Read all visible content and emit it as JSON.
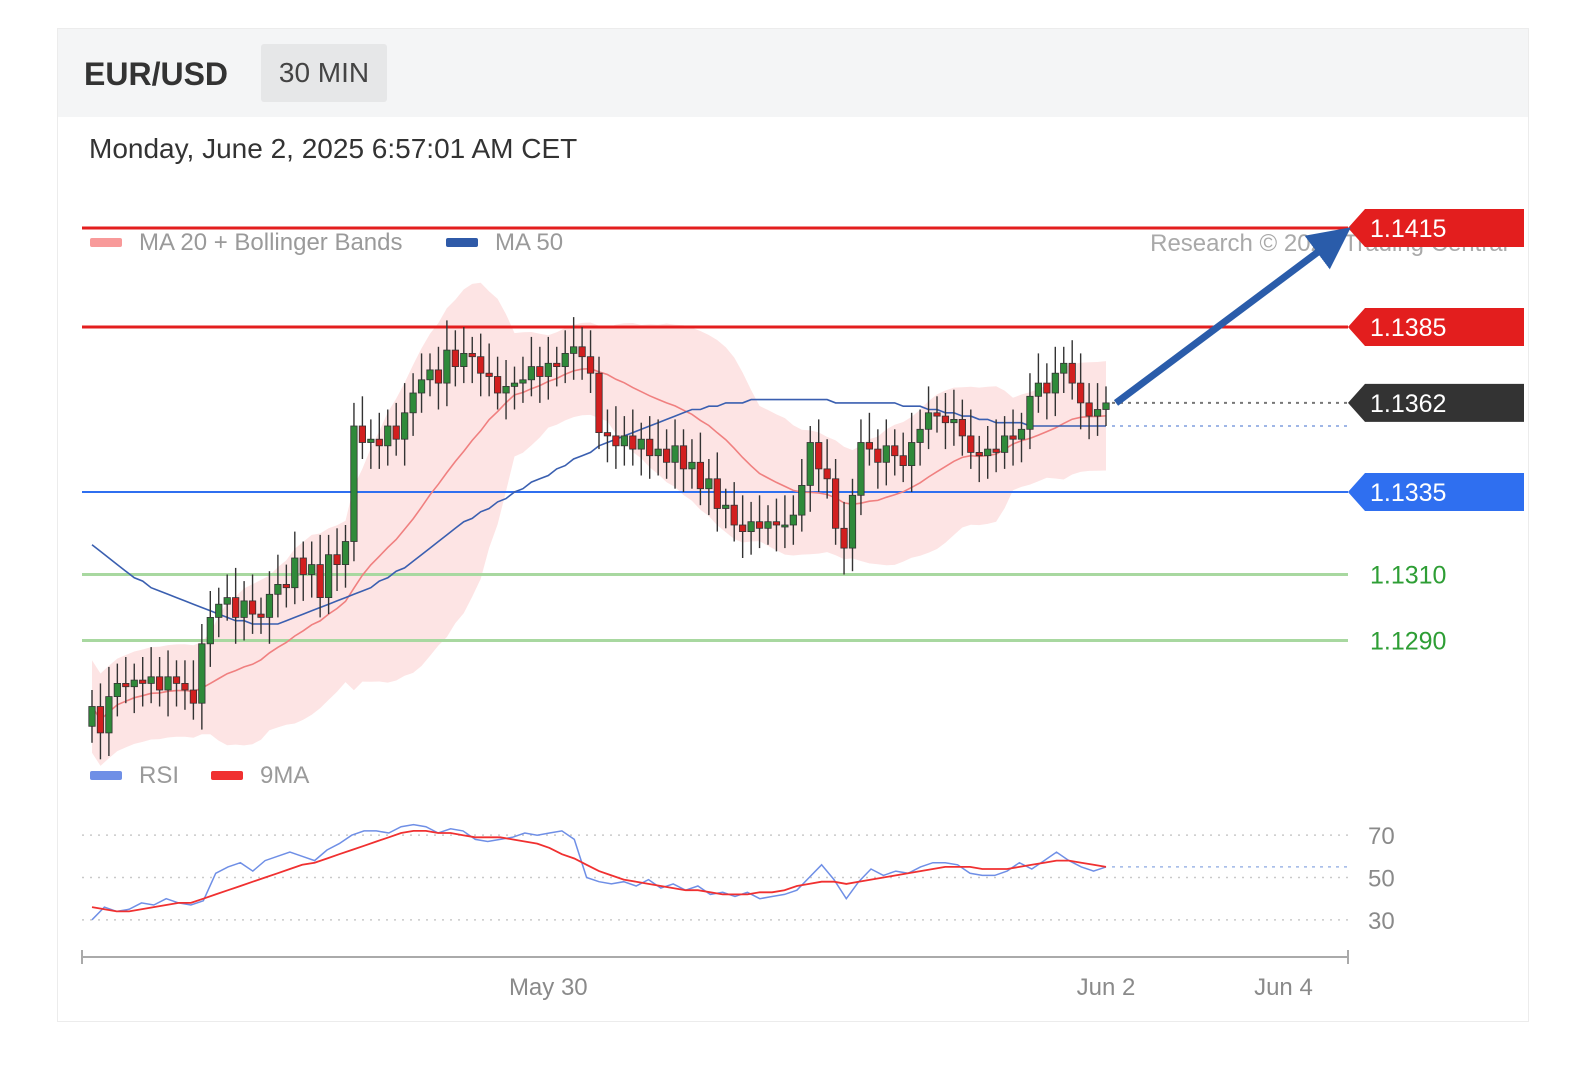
{
  "header": {
    "pair": "EUR/USD",
    "timeframe": "30 MIN"
  },
  "date": "Monday, June 2, 2025 6:57:01 AM CET",
  "legend": {
    "bb_label": "MA 20 + Bollinger Bands",
    "ma50_label": "MA 50",
    "rsi_label": "RSI",
    "rsi_ma_label": "9MA"
  },
  "credit": "Research © 2025 Trading Central",
  "colors": {
    "bullish": "#2f8a3a",
    "bearish": "#d21f1f",
    "band": "#fde4e4",
    "ma20": "#f08080",
    "ma50": "#3a5fb0",
    "resistance": "#e31e1e",
    "support_line": "#a8d8a0",
    "support_text": "#2e9e35",
    "pivot": "#2f6ff0",
    "current": "#333333",
    "arrow": "#2a5caa",
    "rsi": "#6f8fe6",
    "rsi_ma": "#f03030"
  },
  "chart_data": [
    {
      "type": "candlestick",
      "ylim": [
        1.1245,
        1.1445
      ],
      "levels": [
        {
          "label": "1.1415",
          "value": 1.1415,
          "kind": "resistance"
        },
        {
          "label": "1.1385",
          "value": 1.1385,
          "kind": "resistance"
        },
        {
          "label": "1.1362",
          "value": 1.1362,
          "kind": "current"
        },
        {
          "label": "1.1335",
          "value": 1.1335,
          "kind": "pivot"
        },
        {
          "label": "1.1310",
          "value": 1.131,
          "kind": "support"
        },
        {
          "label": "1.1290",
          "value": 1.129,
          "kind": "support"
        }
      ],
      "projection": {
        "direction": "up",
        "from": 1.1362,
        "to": 1.1415
      },
      "x_tick_labels": [
        "May 30",
        "Jun 2",
        "Jun 4"
      ],
      "x_ticks": [
        {
          "label": "May 30",
          "bar": 54
        },
        {
          "label": "Jun 2",
          "bar": 120
        },
        {
          "label": "Jun 4",
          "bar": 141
        }
      ],
      "candles_close": [
        1.127,
        1.1262,
        1.1273,
        1.1277,
        1.1276,
        1.1278,
        1.1277,
        1.1279,
        1.1275,
        1.1279,
        1.1277,
        1.1275,
        1.1271,
        1.1289,
        1.1297,
        1.1301,
        1.1303,
        1.1297,
        1.1302,
        1.1298,
        1.1297,
        1.1304,
        1.1307,
        1.1306,
        1.1315,
        1.131,
        1.1313,
        1.1303,
        1.1316,
        1.1313,
        1.132,
        1.1355,
        1.135,
        1.1351,
        1.1349,
        1.1355,
        1.1351,
        1.1359,
        1.1365,
        1.1369,
        1.1372,
        1.1368,
        1.1378,
        1.1373,
        1.1377,
        1.1376,
        1.1371,
        1.137,
        1.1365,
        1.1367,
        1.1368,
        1.1369,
        1.1373,
        1.137,
        1.1374,
        1.1373,
        1.1377,
        1.1379,
        1.1376,
        1.1371,
        1.1353,
        1.1352,
        1.1349,
        1.1352,
        1.1348,
        1.1351,
        1.1346,
        1.1348,
        1.1344,
        1.1349,
        1.1342,
        1.1344,
        1.1336,
        1.1339,
        1.133,
        1.1331,
        1.1325,
        1.1323,
        1.1326,
        1.1324,
        1.1326,
        1.1325,
        1.1325,
        1.1328,
        1.1337,
        1.135,
        1.1342,
        1.1339,
        1.1324,
        1.1318,
        1.1334,
        1.135,
        1.1348,
        1.1344,
        1.1349,
        1.1346,
        1.1343,
        1.135,
        1.1354,
        1.1359,
        1.1358,
        1.1356,
        1.1357,
        1.1352,
        1.1347,
        1.1346,
        1.1348,
        1.1347,
        1.1352,
        1.1351,
        1.1354,
        1.1364,
        1.1368,
        1.1365,
        1.1371,
        1.1374,
        1.1368,
        1.1362,
        1.1358,
        1.136,
        1.1362
      ],
      "ma50": [
        1.1319,
        1.1317,
        1.1315,
        1.1313,
        1.1311,
        1.1309,
        1.1308,
        1.1306,
        1.1305,
        1.1304,
        1.1303,
        1.1302,
        1.1301,
        1.13,
        1.1299,
        1.1298,
        1.1297,
        1.1296,
        1.1296,
        1.1295,
        1.1295,
        1.1295,
        1.1295,
        1.1296,
        1.1297,
        1.1298,
        1.1299,
        1.13,
        1.1301,
        1.1302,
        1.1303,
        1.1304,
        1.1305,
        1.1306,
        1.1308,
        1.1309,
        1.1311,
        1.1312,
        1.1314,
        1.1316,
        1.1318,
        1.132,
        1.1322,
        1.1324,
        1.1326,
        1.1327,
        1.1329,
        1.133,
        1.1332,
        1.1333,
        1.1335,
        1.1336,
        1.1338,
        1.1339,
        1.134,
        1.1342,
        1.1343,
        1.1345,
        1.1346,
        1.1347,
        1.1349,
        1.135,
        1.1351,
        1.1352,
        1.1353,
        1.1354,
        1.1355,
        1.1356,
        1.1357,
        1.1358,
        1.1359,
        1.136,
        1.136,
        1.1361,
        1.1361,
        1.1362,
        1.1362,
        1.1362,
        1.1363,
        1.1363,
        1.1363,
        1.1363,
        1.1363,
        1.1363,
        1.1363,
        1.1363,
        1.1363,
        1.1363,
        1.1362,
        1.1362,
        1.1362,
        1.1362,
        1.1362,
        1.1362,
        1.1362,
        1.1362,
        1.1361,
        1.1361,
        1.1361,
        1.136,
        1.136,
        1.1359,
        1.1359,
        1.1358,
        1.1358,
        1.1357,
        1.1357,
        1.1356,
        1.1356,
        1.1356,
        1.1356,
        1.1355,
        1.1355,
        1.1355,
        1.1355,
        1.1355,
        1.1355,
        1.1355,
        1.1355,
        1.1355,
        1.1355
      ]
    },
    {
      "type": "line",
      "name": "RSI",
      "ylim": [
        20,
        80
      ],
      "reference_lines": [
        70,
        50,
        30
      ],
      "rsi": [
        30,
        36,
        34,
        35,
        38,
        37,
        40,
        38,
        37,
        39,
        52,
        55,
        57,
        53,
        58,
        60,
        62,
        60,
        58,
        63,
        66,
        70,
        72,
        72,
        71,
        74,
        75,
        74,
        71,
        73,
        72,
        68,
        67,
        68,
        69,
        71,
        70,
        71,
        72,
        68,
        50,
        48,
        47,
        48,
        46,
        49,
        45,
        47,
        44,
        46,
        42,
        43,
        41,
        43,
        40,
        41,
        42,
        44,
        50,
        56,
        49,
        40,
        48,
        54,
        51,
        53,
        52,
        55,
        57,
        57,
        56,
        52,
        51,
        51,
        53,
        57,
        54,
        58,
        62,
        58,
        55,
        53,
        55
      ],
      "rsi_9ma": [
        36,
        35,
        34,
        34,
        35,
        36,
        37,
        38,
        38,
        40,
        42,
        44,
        46,
        48,
        50,
        52,
        54,
        56,
        57,
        59,
        61,
        63,
        65,
        67,
        69,
        71,
        72,
        72,
        71,
        71,
        70,
        69,
        69,
        69,
        68,
        67,
        66,
        64,
        61,
        59,
        56,
        53,
        51,
        49,
        48,
        47,
        46,
        45,
        44,
        44,
        43,
        42,
        42,
        42,
        43,
        43,
        44,
        46,
        47,
        48,
        48,
        47,
        48,
        49,
        50,
        51,
        52,
        53,
        54,
        55,
        55,
        55,
        54,
        54,
        54,
        55,
        56,
        57,
        58,
        58,
        57,
        56,
        55
      ]
    }
  ]
}
